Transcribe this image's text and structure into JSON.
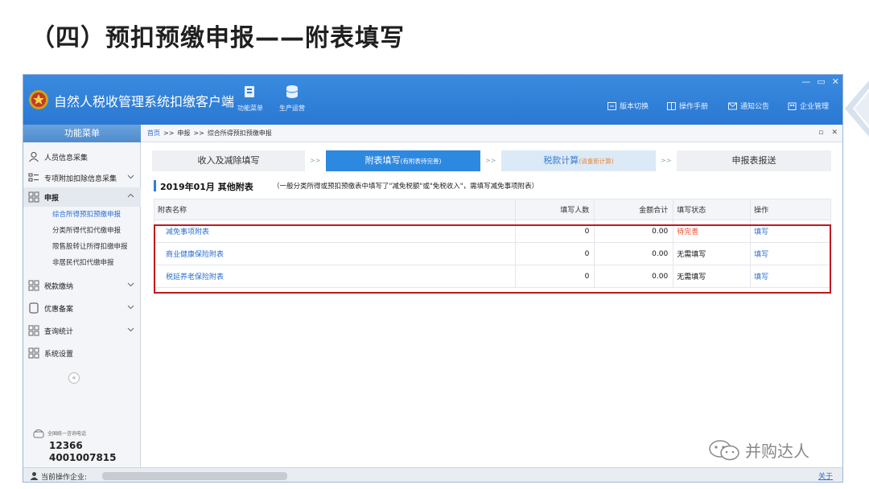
{
  "slide": {
    "title": "（四）预扣预缴申报——附表填写"
  },
  "app": {
    "title": "自然人税收管理系统扣缴客户端",
    "tools": [
      {
        "label": "功能菜单"
      },
      {
        "label": "生产运营"
      }
    ],
    "right_tools": [
      {
        "label": "版本切换"
      },
      {
        "label": "操作手册"
      },
      {
        "label": "通知公告"
      },
      {
        "label": "企业管理"
      }
    ],
    "window_controls": {
      "min": "—",
      "max": "▭",
      "close": "✕"
    }
  },
  "sidebar": {
    "header": "功能菜单",
    "items": [
      {
        "label": "人员信息采集"
      },
      {
        "label": "专项附加扣除信息采集"
      },
      {
        "label": "申报"
      },
      {
        "label": "税款缴纳"
      },
      {
        "label": "优惠备案"
      },
      {
        "label": "查询统计"
      },
      {
        "label": "系统设置"
      }
    ],
    "sub_items": [
      {
        "label": "综合所得预扣预缴申报"
      },
      {
        "label": "分类所得代扣代缴申报"
      },
      {
        "label": "限售股转让所得扣缴申报"
      },
      {
        "label": "非居民代扣代缴申报"
      }
    ],
    "collapse": "«",
    "hotline_label": "全国统一咨询电话",
    "hotline1": "12366",
    "hotline2": "4001007815"
  },
  "breadcrumb": {
    "home": "首页",
    "sep1": ">>",
    "level1": "申报",
    "sep2": ">>",
    "level2": "综合所得预扣预缴申报",
    "ctl_restore": "▫",
    "ctl_close": "✕"
  },
  "steps": [
    {
      "label": "收入及减除填写",
      "note": ""
    },
    {
      "label": "附表填写",
      "note": "(有附表待完善)"
    },
    {
      "label": "税款计算",
      "note": "(请重新计算)"
    },
    {
      "label": "申报表报送",
      "note": ""
    }
  ],
  "step_arrow": ">>",
  "period": {
    "title": "2019年01月  其他附表",
    "note": "（一般分类所得或预扣预缴表中填写了\"减免税额\"或\"免税收入\"，需填写减免事项附表）"
  },
  "table": {
    "headers": {
      "name": "附表名称",
      "count": "填写人数",
      "amount": "金额合计",
      "status": "填写状态",
      "action": "操作"
    },
    "rows": [
      {
        "name": "减免事项附表",
        "count": "0",
        "amount": "0.00",
        "status": "待完善",
        "action": "填写"
      },
      {
        "name": "商业健康保险附表",
        "count": "0",
        "amount": "0.00",
        "status": "无需填写",
        "action": "填写"
      },
      {
        "name": "税延养老保险附表",
        "count": "0",
        "amount": "0.00",
        "status": "无需填写",
        "action": "填写"
      }
    ]
  },
  "statusbar": {
    "label": "当前操作企业:",
    "about": "关于"
  },
  "watermark": {
    "text": "并购达人"
  },
  "colors": {
    "titlebar": "#2a78d2",
    "accent": "#2d88e0",
    "highlight_box": "#c0181f",
    "warn": "#e24a2a"
  }
}
